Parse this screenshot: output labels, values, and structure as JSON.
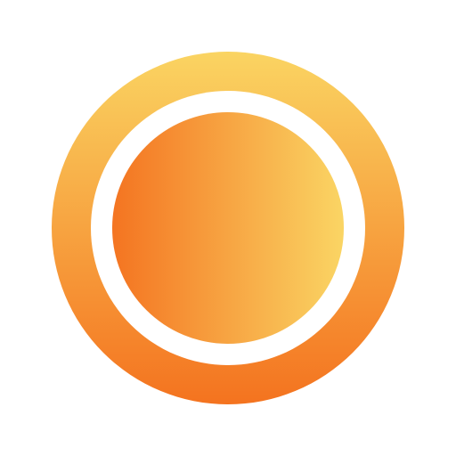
{
  "icon": {
    "name": "sun-circle-icon",
    "colors": {
      "background": "#ffffff",
      "outer_ring_top": "#fad462",
      "outer_ring_bottom": "#f4731f",
      "gap": "#ffffff",
      "inner_left": "#f47421",
      "inner_right": "#fad564"
    }
  }
}
